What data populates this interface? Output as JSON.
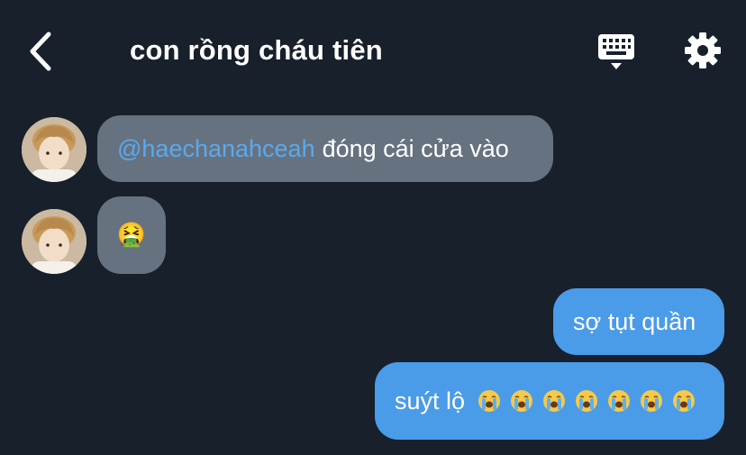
{
  "header": {
    "title": "con rồng cháu tiên",
    "back_icon": "chevron-left-icon",
    "keyboard_icon": "keyboard-icon",
    "settings_icon": "gear-icon"
  },
  "messages": [
    {
      "side": "in",
      "mention": "@haechanahceah",
      "text": "đóng cái cửa vào"
    },
    {
      "side": "in",
      "text": "🤮"
    },
    {
      "side": "out",
      "text": "sợ tụt quần"
    },
    {
      "side": "out",
      "text": "suýt lộ",
      "emoji_name": "loudly-crying-face",
      "emoji_count": 7
    }
  ],
  "colors": {
    "background": "#17202b",
    "incoming_bubble": "#66727f",
    "outgoing_bubble": "#4a9be8",
    "mention": "#59a9f0"
  }
}
